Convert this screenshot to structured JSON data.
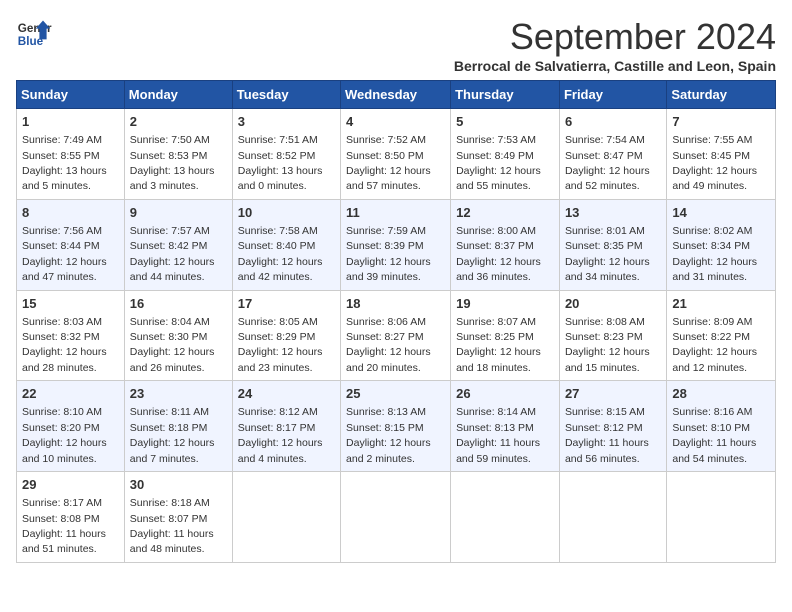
{
  "header": {
    "logo_line1": "General",
    "logo_line2": "Blue",
    "month_title": "September 2024",
    "subtitle": "Berrocal de Salvatierra, Castille and Leon, Spain"
  },
  "days_of_week": [
    "Sunday",
    "Monday",
    "Tuesday",
    "Wednesday",
    "Thursday",
    "Friday",
    "Saturday"
  ],
  "weeks": [
    [
      {
        "day": "1",
        "sunrise": "7:49 AM",
        "sunset": "8:55 PM",
        "daylight": "13 hours and 5 minutes."
      },
      {
        "day": "2",
        "sunrise": "7:50 AM",
        "sunset": "8:53 PM",
        "daylight": "13 hours and 3 minutes."
      },
      {
        "day": "3",
        "sunrise": "7:51 AM",
        "sunset": "8:52 PM",
        "daylight": "13 hours and 0 minutes."
      },
      {
        "day": "4",
        "sunrise": "7:52 AM",
        "sunset": "8:50 PM",
        "daylight": "12 hours and 57 minutes."
      },
      {
        "day": "5",
        "sunrise": "7:53 AM",
        "sunset": "8:49 PM",
        "daylight": "12 hours and 55 minutes."
      },
      {
        "day": "6",
        "sunrise": "7:54 AM",
        "sunset": "8:47 PM",
        "daylight": "12 hours and 52 minutes."
      },
      {
        "day": "7",
        "sunrise": "7:55 AM",
        "sunset": "8:45 PM",
        "daylight": "12 hours and 49 minutes."
      }
    ],
    [
      {
        "day": "8",
        "sunrise": "7:56 AM",
        "sunset": "8:44 PM",
        "daylight": "12 hours and 47 minutes."
      },
      {
        "day": "9",
        "sunrise": "7:57 AM",
        "sunset": "8:42 PM",
        "daylight": "12 hours and 44 minutes."
      },
      {
        "day": "10",
        "sunrise": "7:58 AM",
        "sunset": "8:40 PM",
        "daylight": "12 hours and 42 minutes."
      },
      {
        "day": "11",
        "sunrise": "7:59 AM",
        "sunset": "8:39 PM",
        "daylight": "12 hours and 39 minutes."
      },
      {
        "day": "12",
        "sunrise": "8:00 AM",
        "sunset": "8:37 PM",
        "daylight": "12 hours and 36 minutes."
      },
      {
        "day": "13",
        "sunrise": "8:01 AM",
        "sunset": "8:35 PM",
        "daylight": "12 hours and 34 minutes."
      },
      {
        "day": "14",
        "sunrise": "8:02 AM",
        "sunset": "8:34 PM",
        "daylight": "12 hours and 31 minutes."
      }
    ],
    [
      {
        "day": "15",
        "sunrise": "8:03 AM",
        "sunset": "8:32 PM",
        "daylight": "12 hours and 28 minutes."
      },
      {
        "day": "16",
        "sunrise": "8:04 AM",
        "sunset": "8:30 PM",
        "daylight": "12 hours and 26 minutes."
      },
      {
        "day": "17",
        "sunrise": "8:05 AM",
        "sunset": "8:29 PM",
        "daylight": "12 hours and 23 minutes."
      },
      {
        "day": "18",
        "sunrise": "8:06 AM",
        "sunset": "8:27 PM",
        "daylight": "12 hours and 20 minutes."
      },
      {
        "day": "19",
        "sunrise": "8:07 AM",
        "sunset": "8:25 PM",
        "daylight": "12 hours and 18 minutes."
      },
      {
        "day": "20",
        "sunrise": "8:08 AM",
        "sunset": "8:23 PM",
        "daylight": "12 hours and 15 minutes."
      },
      {
        "day": "21",
        "sunrise": "8:09 AM",
        "sunset": "8:22 PM",
        "daylight": "12 hours and 12 minutes."
      }
    ],
    [
      {
        "day": "22",
        "sunrise": "8:10 AM",
        "sunset": "8:20 PM",
        "daylight": "12 hours and 10 minutes."
      },
      {
        "day": "23",
        "sunrise": "8:11 AM",
        "sunset": "8:18 PM",
        "daylight": "12 hours and 7 minutes."
      },
      {
        "day": "24",
        "sunrise": "8:12 AM",
        "sunset": "8:17 PM",
        "daylight": "12 hours and 4 minutes."
      },
      {
        "day": "25",
        "sunrise": "8:13 AM",
        "sunset": "8:15 PM",
        "daylight": "12 hours and 2 minutes."
      },
      {
        "day": "26",
        "sunrise": "8:14 AM",
        "sunset": "8:13 PM",
        "daylight": "11 hours and 59 minutes."
      },
      {
        "day": "27",
        "sunrise": "8:15 AM",
        "sunset": "8:12 PM",
        "daylight": "11 hours and 56 minutes."
      },
      {
        "day": "28",
        "sunrise": "8:16 AM",
        "sunset": "8:10 PM",
        "daylight": "11 hours and 54 minutes."
      }
    ],
    [
      {
        "day": "29",
        "sunrise": "8:17 AM",
        "sunset": "8:08 PM",
        "daylight": "11 hours and 51 minutes."
      },
      {
        "day": "30",
        "sunrise": "8:18 AM",
        "sunset": "8:07 PM",
        "daylight": "11 hours and 48 minutes."
      },
      null,
      null,
      null,
      null,
      null
    ]
  ]
}
